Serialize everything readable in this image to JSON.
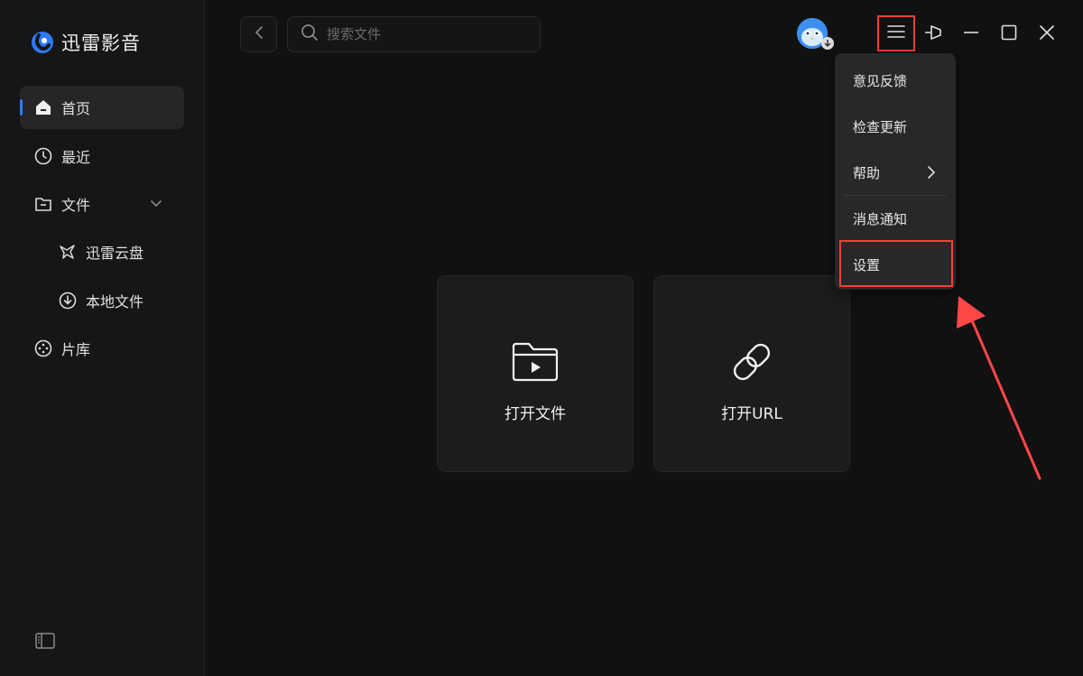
{
  "app": {
    "name": "迅雷影音"
  },
  "sidebar": {
    "items": [
      {
        "label": "首页"
      },
      {
        "label": "最近"
      },
      {
        "label": "文件"
      },
      {
        "label": "迅雷云盘"
      },
      {
        "label": "本地文件"
      },
      {
        "label": "片库"
      }
    ]
  },
  "search": {
    "placeholder": "搜索文件"
  },
  "cards": [
    {
      "label": "打开文件"
    },
    {
      "label": "打开URL"
    }
  ],
  "menu": {
    "items": [
      {
        "label": "意见反馈"
      },
      {
        "label": "检查更新"
      },
      {
        "label": "帮助"
      },
      {
        "label": "消息通知"
      },
      {
        "label": "设置"
      }
    ]
  },
  "colors": {
    "accent": "#2f7bff",
    "highlight": "#ff3b3b",
    "background": "#111111",
    "sidebar": "#161616"
  }
}
